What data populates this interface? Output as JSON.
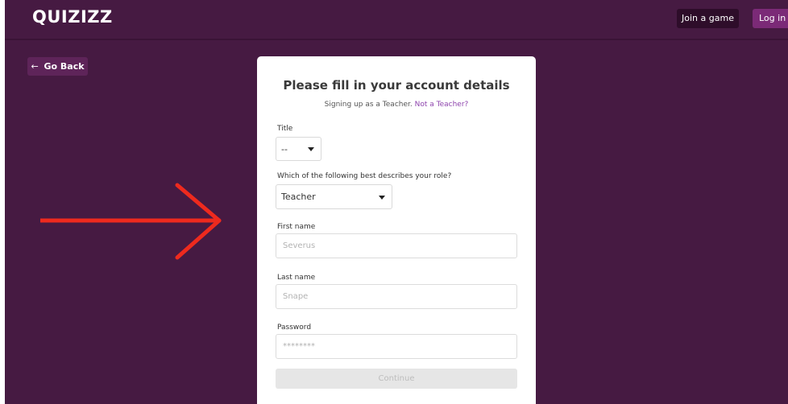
{
  "header": {
    "logo": "QUIZIZZ",
    "join_label": "Join a game",
    "login_label": "Log in"
  },
  "nav": {
    "back_arrow": "←",
    "back_label": "Go Back"
  },
  "form": {
    "title": "Please fill in your account details",
    "subtitle_prefix": "Signing up as a Teacher.",
    "subtitle_link": "Not a Teacher?",
    "title_label": "Title",
    "title_value": "--",
    "role_label": "Which of the following best describes your role?",
    "role_value": "Teacher",
    "first_name_label": "First name",
    "first_name_placeholder": "Severus",
    "last_name_label": "Last name",
    "last_name_placeholder": "Snape",
    "password_label": "Password",
    "password_placeholder": "********",
    "continue_label": "Continue"
  },
  "annotation": {
    "arrow_color": "#ee2a1e",
    "icon": "right-arrow-icon"
  },
  "colors": {
    "background": "#461a42",
    "card": "#ffffff",
    "link": "#8e44ad",
    "login_button": "#7b2a77",
    "join_button": "#2e0d2a"
  }
}
